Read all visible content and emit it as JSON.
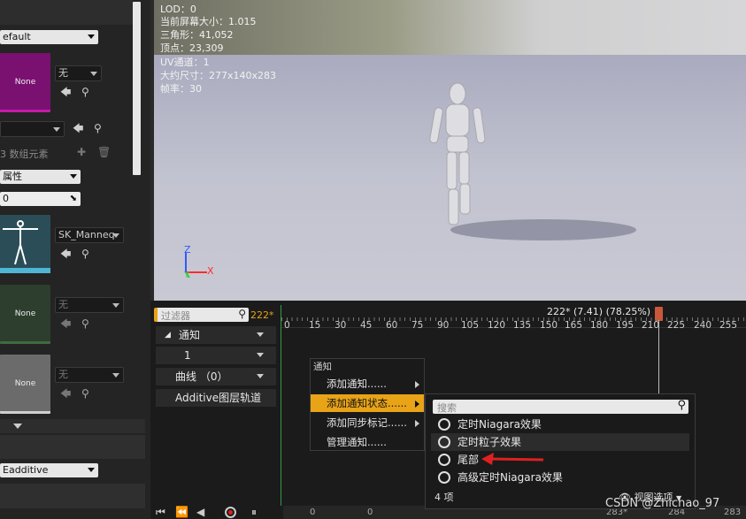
{
  "left_panel": {
    "top_combo": "efault",
    "material1": {
      "thumb_label": "None",
      "select": "无"
    },
    "array_combo_value": "",
    "array_elements_label": "数组元素",
    "array_elements_prefix": "3",
    "property_combo": "属性",
    "number_field": "0",
    "mesh": {
      "select": "SK_Manneq"
    },
    "material2": {
      "thumb_label": "None",
      "select": "无"
    },
    "material3": {
      "thumb_label": "None",
      "select": "无"
    },
    "additive_combo": "Eadditive"
  },
  "viewport": {
    "stats": [
      "LOD：0",
      "当前屏幕大小：1.015",
      "三角形：41,052",
      "顶点：23,309",
      "UV通道：1",
      "大约尺寸：277x140x283",
      "帧率：30"
    ],
    "axis": {
      "z": "Z",
      "x": "X",
      "y": "Y"
    }
  },
  "timeline": {
    "filter_placeholder": "过滤器",
    "frame_value": "222*",
    "tracks": {
      "notify": "通知",
      "notify_index": "1",
      "curves": "曲线 （0）",
      "additive": "Additive图层轨道"
    },
    "header_readout": "222* (7.41) (78.25%)",
    "ticks": [
      "0",
      "15",
      "30",
      "45",
      "60",
      "75",
      "90",
      "105",
      "120",
      "135",
      "150",
      "165",
      "180",
      "195",
      "210",
      "225",
      "240",
      "255"
    ],
    "bottom_numbers": [
      "0",
      "0",
      "283*",
      "284",
      "283"
    ]
  },
  "context_menu": {
    "section": "通知",
    "items": [
      "添加通知......",
      "添加通知状态......",
      "添加同步标记......",
      "管理通知......"
    ]
  },
  "submenu": {
    "search_placeholder": "搜索",
    "items": [
      "定时Niagara效果",
      "定时粒子效果",
      "尾部",
      "高级定时Niagara效果"
    ],
    "count": "4 项",
    "view_options": "视图选项"
  },
  "watermark": "CSDN @Zhichao_97",
  "colors": {
    "highlight": "#e8a317",
    "arrow": "#e02020",
    "magenta": "#c1169c"
  }
}
